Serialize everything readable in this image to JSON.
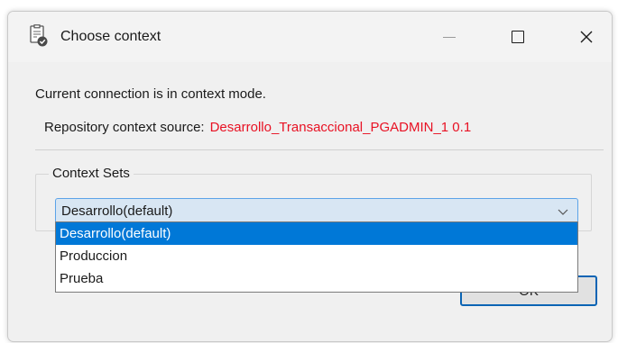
{
  "window": {
    "title": "Choose context",
    "icon": "context-document-check-icon"
  },
  "message": "Current connection is in context mode.",
  "repository": {
    "label": "Repository context source:",
    "value": "Desarrollo_Transaccional_PGADMIN_1 0.1",
    "value_color": "#e81123"
  },
  "context_sets": {
    "group_label": "Context Sets",
    "selected": "Desarrollo(default)",
    "options": [
      "Desarrollo(default)",
      "Produccion",
      "Prueba"
    ]
  },
  "buttons": {
    "ok": "OK"
  },
  "colors": {
    "selection": "#0078d7",
    "combo_border": "#5ca3e8"
  }
}
